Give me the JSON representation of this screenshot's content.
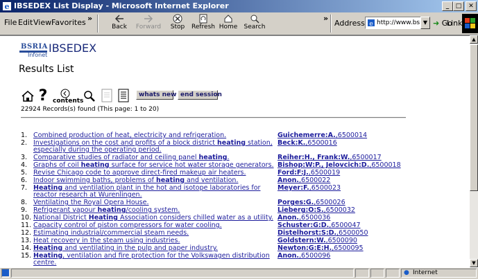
{
  "window": {
    "title": "IBSEDEX List Display - Microsoft Internet Explorer",
    "min": "_",
    "max": "□",
    "close": "✕"
  },
  "menu": {
    "file": "File",
    "edit": "Edit",
    "view": "View",
    "favorites": "Favorites",
    "chev": "»"
  },
  "toolbar": {
    "back": "Back",
    "forward": "Forward",
    "stop": "Stop",
    "refresh": "Refresh",
    "home": "Home",
    "search": "Search",
    "chev": "»",
    "address_label": "Address",
    "address_value": "http://www.bsria.co.uk/scripts/net",
    "go": "Go",
    "links": "Links",
    "links_chev": "»"
  },
  "logo": {
    "bsria": "BSRIA",
    "infonet": "Infonet",
    "brand": "IBSEDEX"
  },
  "page": {
    "title": "Results List",
    "contents_label": "contents",
    "whats_new": "whats new",
    "end_session": "end session",
    "count": "22924 Records(s) found (This page: 1 to 20)"
  },
  "results": [
    {
      "num": "1.",
      "title_html": "Combined production of heat, electricity and refrigeration.",
      "author_html": "<b>Guichemerre:A.</b>,6500014"
    },
    {
      "num": "2.",
      "title_html": "Investigations on the cost and profits of a block district <b>heating</b> station, especially during the operating period.",
      "author_html": "<b>Beck:K.</b>,6500016"
    },
    {
      "num": "3.",
      "title_html": "Comparative studies of radiator and ceiling panel <b>heating</b>.",
      "author_html": "<b>Reiher:H., Frank:W.</b>,6500017"
    },
    {
      "num": "4.",
      "title_html": "Graphs of coil <b>heating</b> surface for service hot water storage generators.",
      "author_html": "<b>Bishop:W:P., Jelovcich:D.</b>,6500018"
    },
    {
      "num": "5.",
      "title_html": "Revise Chicago code to approve direct-fired makeup air heaters.",
      "author_html": "<b>Ford:F:J.</b>,6500019"
    },
    {
      "num": "6.",
      "title_html": "Indoor swimming baths, problems of <b>heating</b> and ventilation.",
      "author_html": "<b>Anon.</b>,6500022"
    },
    {
      "num": "7.",
      "title_html": "<b>Heating</b> and ventilation plant in the hot and isotope laboratories for reactor research at Wurenlingen.",
      "author_html": "<b>Meyer:F.</b>,6500023"
    },
    {
      "num": "8.",
      "title_html": "Ventilating the Royal Opera House.",
      "author_html": "<b>Porges:G.</b>,6500026"
    },
    {
      "num": "9.",
      "title_html": "Refrigerant vapour <b>heating</b>/cooling system.",
      "author_html": "<b>Lieberg:O:S.</b>,6500032"
    },
    {
      "num": "10.",
      "title_html": "National District <b>Heating</b> Association considers chilled water as a utility.",
      "author_html": "<b>Anon.</b>,6500036"
    },
    {
      "num": "11.",
      "title_html": "Capacity control of piston compressors for water cooling.",
      "author_html": "<b>Schuster:G:D.</b>,6500047"
    },
    {
      "num": "12.",
      "title_html": "Estimating industrial/commercial steam needs.",
      "author_html": "<b>Distelhorst:S:D.</b>,6500050"
    },
    {
      "num": "13.",
      "title_html": "Heat recovery in the steam using industries.",
      "author_html": "<b>Goldstern:W.</b>,6500090"
    },
    {
      "num": "14.",
      "title_html": "<b>Heating</b> and ventilating in the pulp and paper industry.",
      "author_html": "<b>Newton:G:E:H.</b>,6500095"
    },
    {
      "num": "15.",
      "title_html": "<b>Heating</b>, ventilation and fire protection for the Volkswagen distribution centre.",
      "author_html": "<b>Anon.</b>,6500096"
    }
  ],
  "status": {
    "zone": "Internet"
  }
}
